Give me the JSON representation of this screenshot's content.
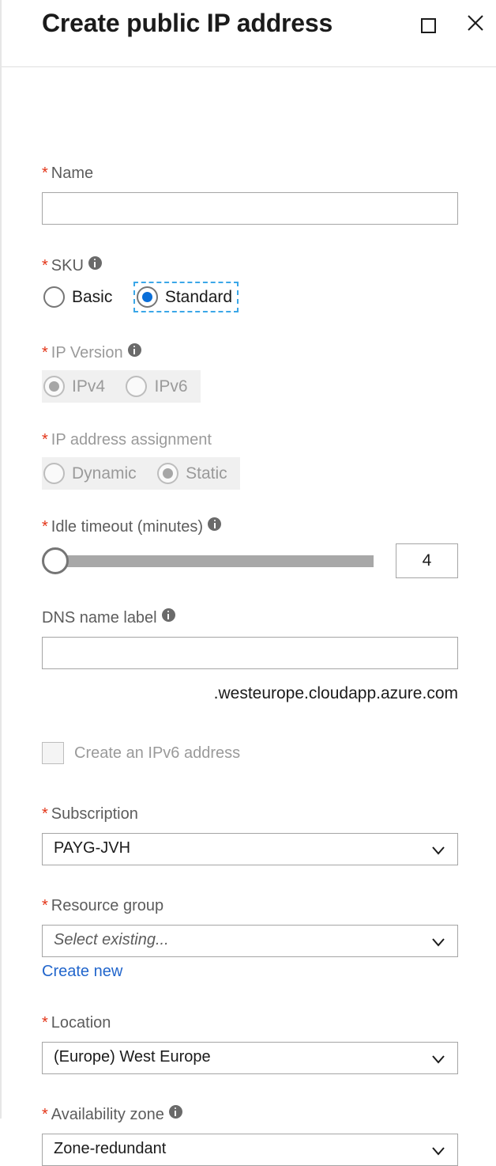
{
  "header": {
    "title": "Create public IP address",
    "maximize_icon": "maximize-square-icon",
    "close_icon": "close-x-icon"
  },
  "form": {
    "name": {
      "label": "Name",
      "required_marker": "*",
      "value": "",
      "placeholder": ""
    },
    "sku": {
      "label": "SKU",
      "required_marker": "*",
      "info_icon": "info-icon",
      "options": [
        "Basic",
        "Standard"
      ],
      "selected": "Standard",
      "focused": "Standard"
    },
    "ip_version": {
      "label": "IP Version",
      "required_marker": "*",
      "info_icon": "info-icon",
      "options": [
        "IPv4",
        "IPv6"
      ],
      "selected": "IPv4",
      "disabled": true
    },
    "ip_assignment": {
      "label": "IP address assignment",
      "required_marker": "*",
      "options": [
        "Dynamic",
        "Static"
      ],
      "selected": "Static",
      "disabled": true
    },
    "idle_timeout": {
      "label": "Idle timeout (minutes)",
      "required_marker": "*",
      "info_icon": "info-icon",
      "value": "4",
      "min": 4,
      "max": 30,
      "slider_position_percent": 0
    },
    "dns_name_label": {
      "label": "DNS name label",
      "info_icon": "info-icon",
      "value": "",
      "suffix": ".westeurope.cloudapp.azure.com"
    },
    "create_ipv6": {
      "label": "Create an IPv6 address",
      "checked": false,
      "disabled": true
    },
    "subscription": {
      "label": "Subscription",
      "required_marker": "*",
      "value": "PAYG-JVH"
    },
    "resource_group": {
      "label": "Resource group",
      "required_marker": "*",
      "placeholder": "Select existing...",
      "create_new_link": "Create new"
    },
    "location": {
      "label": "Location",
      "required_marker": "*",
      "value": "(Europe) West Europe"
    },
    "availability_zone": {
      "label": "Availability zone",
      "required_marker": "*",
      "info_icon": "info-icon",
      "value": "Zone-redundant"
    }
  },
  "colors": {
    "required_red": "#e33417",
    "link_blue": "#2266cc",
    "radio_accent": "#0a6ed8",
    "focus_ring": "#3ba7e8",
    "disabled_bg": "#f0f0f0",
    "border_grey": "#a5a5a5"
  }
}
